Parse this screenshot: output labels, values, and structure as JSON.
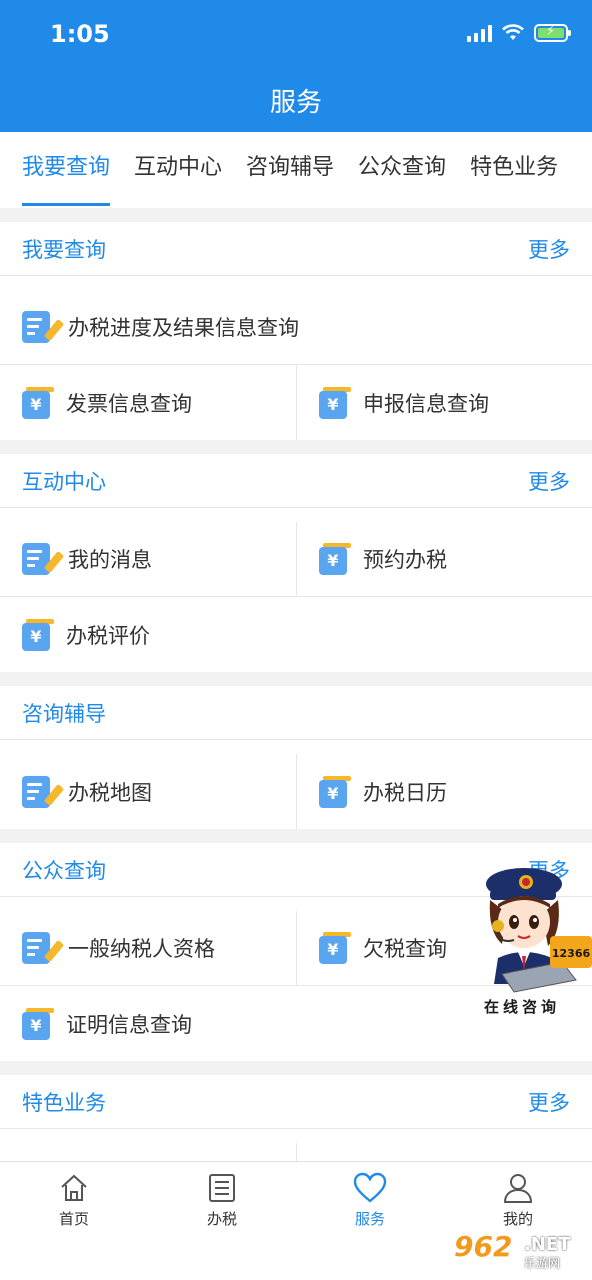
{
  "status_bar": {
    "time": "1:05"
  },
  "header": {
    "title": "服务"
  },
  "tabs": [
    {
      "label": "我要查询"
    },
    {
      "label": "互动中心"
    },
    {
      "label": "咨询辅导"
    },
    {
      "label": "公众查询"
    },
    {
      "label": "特色业务"
    }
  ],
  "sections": {
    "query": {
      "title": "我要查询",
      "more": "更多",
      "items": [
        "办税进度及结果信息查询",
        "发票信息查询",
        "申报信息查询"
      ]
    },
    "interact": {
      "title": "互动中心",
      "more": "更多",
      "items": [
        "我的消息",
        "预约办税",
        "办税评价"
      ]
    },
    "consult": {
      "title": "咨询辅导",
      "items": [
        "办税地图",
        "办税日历"
      ]
    },
    "public": {
      "title": "公众查询",
      "more": "更多",
      "items": [
        "一般纳税人资格",
        "欠税查询",
        "证明信息查询"
      ]
    },
    "special": {
      "title": "特色业务",
      "more": "更多"
    }
  },
  "mascot": {
    "caption": "在线咨询",
    "phone": "12366"
  },
  "tabbar": [
    {
      "label": "首页",
      "icon": "home-icon"
    },
    {
      "label": "办税",
      "icon": "list-icon"
    },
    {
      "label": "服务",
      "icon": "heart-icon"
    },
    {
      "label": "我的",
      "icon": "user-icon"
    }
  ],
  "watermark": {
    "brand": "962",
    "domain": ".NET",
    "site": "乐游网"
  },
  "colors": {
    "primary": "#1f8ae8",
    "icon_blue": "#5aa5f0",
    "icon_yellow": "#f5b82a"
  }
}
